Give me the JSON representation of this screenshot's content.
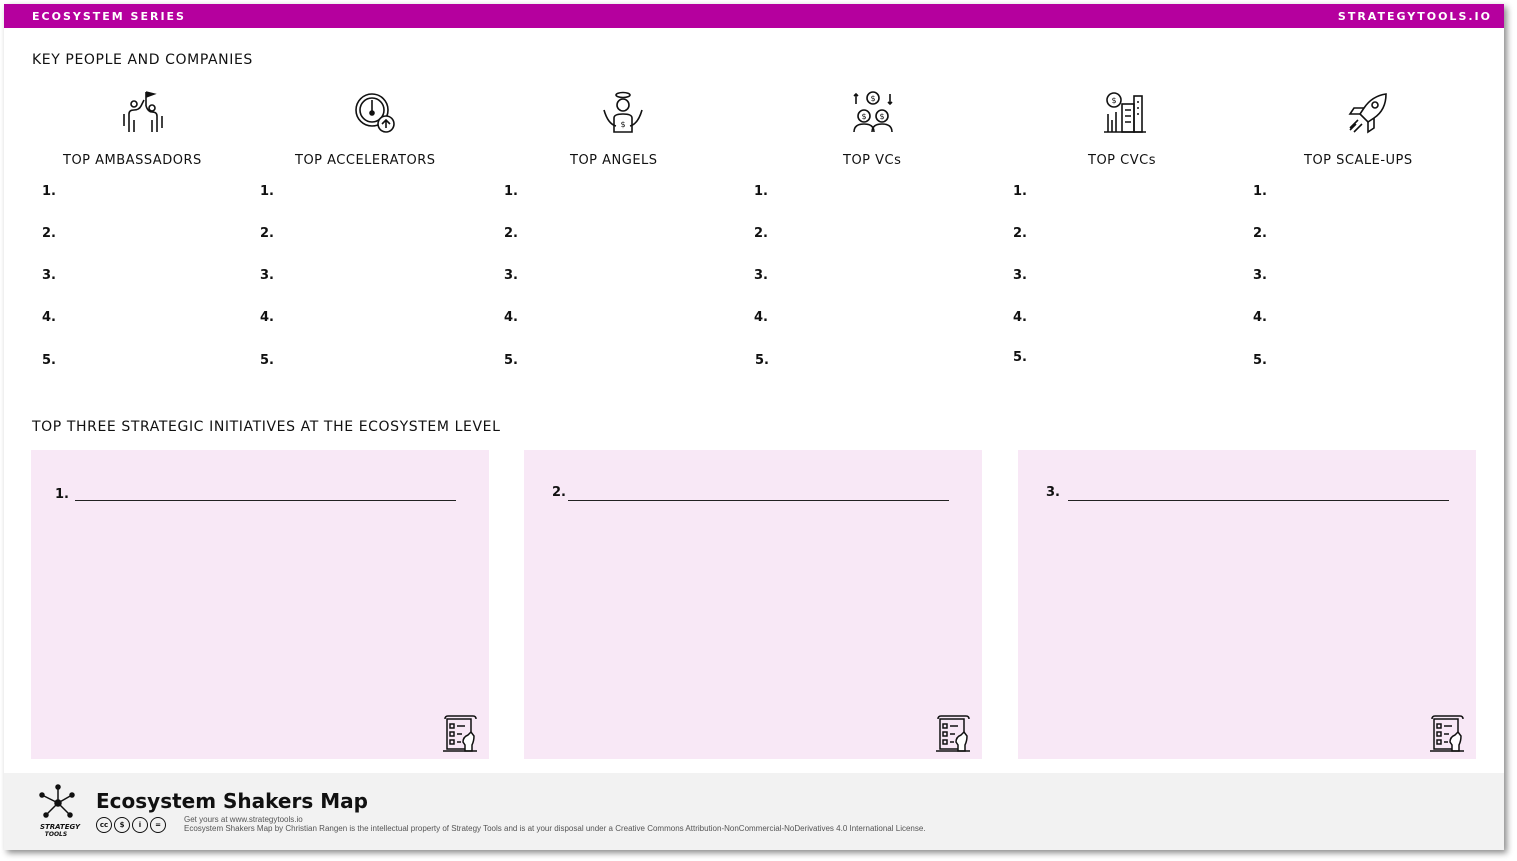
{
  "header": {
    "series": "ECOSYSTEM SERIES",
    "site": "STRATEGYTOOLS.IO"
  },
  "key_section": {
    "title": "KEY PEOPLE AND COMPANIES"
  },
  "columns": [
    {
      "title": "TOP AMBASSADORS",
      "icon": "ambassadors-flag-icon",
      "numbers": [
        "1.",
        "2.",
        "3.",
        "4.",
        "5."
      ]
    },
    {
      "title": "TOP ACCELERATORS",
      "icon": "accelerator-gauge-icon",
      "numbers": [
        "1.",
        "2.",
        "3.",
        "4.",
        "5."
      ]
    },
    {
      "title": "TOP ANGELS",
      "icon": "angel-investor-icon",
      "numbers": [
        "1.",
        "2.",
        "3.",
        "4.",
        "5."
      ]
    },
    {
      "title": "TOP VCs",
      "icon": "venture-capital-icon",
      "numbers": [
        "1.",
        "2.",
        "3.",
        "4.",
        "5."
      ]
    },
    {
      "title": "TOP CVCs",
      "icon": "corporate-building-icon",
      "numbers": [
        "1.",
        "2.",
        "3.",
        "4.",
        "5."
      ]
    },
    {
      "title": "TOP SCALE-UPS",
      "icon": "rocket-icon",
      "numbers": [
        "1.",
        "2.",
        "3.",
        "4.",
        "5."
      ]
    }
  ],
  "initiatives": {
    "title": "TOP THREE STRATEGIC INITIATIVES AT THE ECOSYSTEM LEVEL",
    "boxes": [
      {
        "number": "1."
      },
      {
        "number": "2."
      },
      {
        "number": "3."
      }
    ],
    "icon": "strategy-plan-chess-icon",
    "box_color": "#f8e8f6"
  },
  "footer": {
    "title": "Ecosystem Shakers Map",
    "logo_text_1": "STRATEGY",
    "logo_text_2": "TOOLS",
    "get_yours": "Get yours at www.strategytools.io",
    "license": "Ecosystem Shakers Map by Christian Rangen is the intellectual property of Strategy Tools and is at your disposal under a Creative Commons Attribution-NonCommercial-NoDerivatives 4.0 International License.",
    "cc_icons": [
      "cc",
      "$",
      "i",
      "="
    ]
  },
  "colors": {
    "accent": "#b5009e",
    "box": "#f8e8f6",
    "footer": "#f2f2f2"
  }
}
